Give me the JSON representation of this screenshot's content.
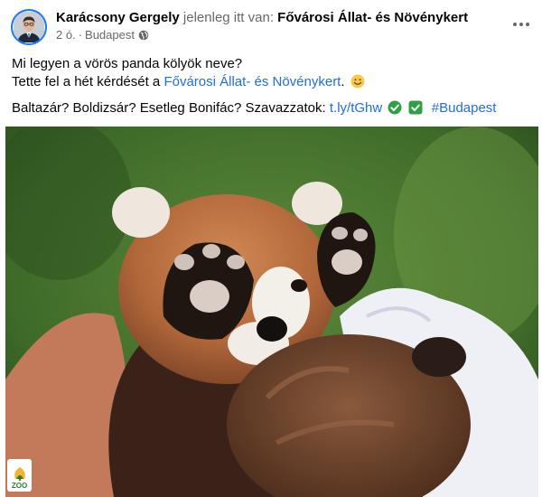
{
  "post": {
    "author": "Karácsony Gergely",
    "checkin_prefix": "jelenleg itt van:",
    "place": "Fővárosi Állat- és Növénykert",
    "time": "2 ó.",
    "separator": "·",
    "location": "Budapest",
    "privacy_icon": "globe-icon",
    "more_icon": "ellipsis-icon"
  },
  "body": {
    "line1": "Mi legyen a vörös panda kölyök neve?",
    "line2_prefix": "Tette fel a hét kérdését a",
    "line2_link": "Fővárosi Állat- és Növénykert",
    "line2_suffix": ".",
    "line2_emoji": "smile-emoji",
    "line3_text": "Baltazár? Boldizsár? Esetleg Bonifác? Szavazzatok:",
    "line3_link": "t.ly/tGhw",
    "line3_icons": [
      "check-circle-icon",
      "check-box-icon"
    ],
    "hashtag": "#Budapest"
  },
  "photo": {
    "subject": "red panda cub covering its eyes with its paws",
    "watermark": {
      "icon": "zoo-logo-icon",
      "text": "ZOO"
    }
  },
  "colors": {
    "link": "#216fdb",
    "muted": "#65676b",
    "check_green": "#2ea043",
    "avatar_ring": "#1877f2"
  }
}
